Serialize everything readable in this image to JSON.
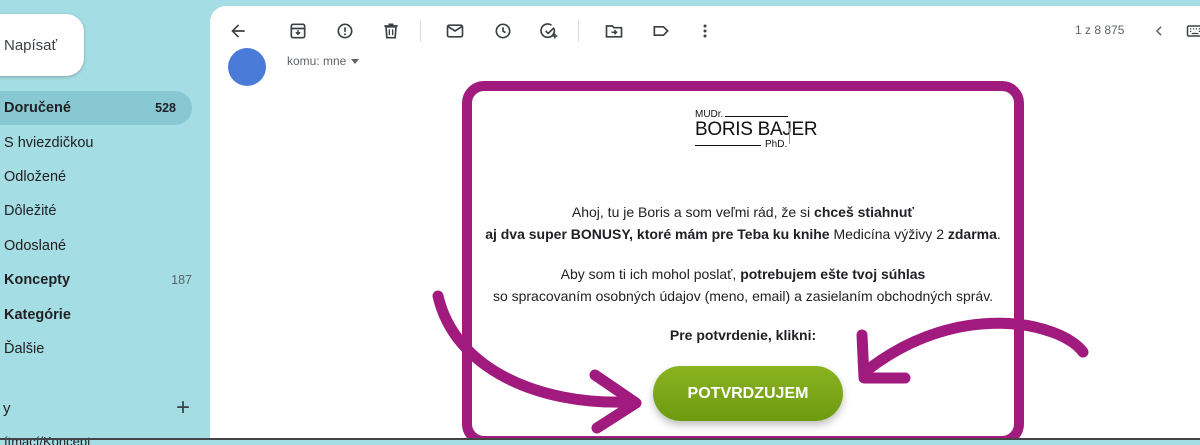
{
  "sidebar": {
    "compose_label": "Napísať",
    "items": [
      {
        "label": "Doručené",
        "count": "528"
      },
      {
        "label": "S hviezdičkou",
        "count": ""
      },
      {
        "label": "Odložené",
        "count": ""
      },
      {
        "label": "Dôležité",
        "count": ""
      },
      {
        "label": "Odoslané",
        "count": ""
      },
      {
        "label": "Koncepty",
        "count": "187"
      },
      {
        "label": "Kategórie",
        "count": ""
      },
      {
        "label": "Ďalšie",
        "count": ""
      }
    ],
    "labels_heading": "y",
    "labels_cut": "ítmací/Koncept"
  },
  "toolbar": {
    "icons": [
      "back-arrow-icon",
      "archive-icon",
      "report-spam-icon",
      "delete-icon",
      "mark-unread-icon",
      "snooze-icon",
      "add-task-icon",
      "move-to-icon",
      "label-icon",
      "more-icon"
    ],
    "pager": "1 z 8 875"
  },
  "message": {
    "to_line": "komu: mne",
    "logo": {
      "prefix": "MUDr.",
      "name": "BORIS BAJER",
      "suffix": "PhD."
    },
    "p1_a": "Ahoj, tu je Boris a som veľmi rád, že si ",
    "p1_b": "chceš stiahnuť",
    "p1_c": "aj dva super BONUSY, ktoré mám pre Teba ku knihe",
    "p1_d": " Medicína výživy 2 ",
    "p1_e": "zdarma",
    "p1_f": ".",
    "p2_a": "Aby som ti ich mohol poslať, ",
    "p2_b": "potrebujem ešte tvoj súhlas",
    "p2_c": "so spracovaním osobných údajov (meno, email) a zasielaním obchodných správ.",
    "p3": "Pre potvrdenie, klikni:",
    "cta": "POTVRDZUJEM"
  },
  "colors": {
    "frame": "#a11a7d",
    "cta": "#7ba718",
    "background": "#a5dde4"
  }
}
